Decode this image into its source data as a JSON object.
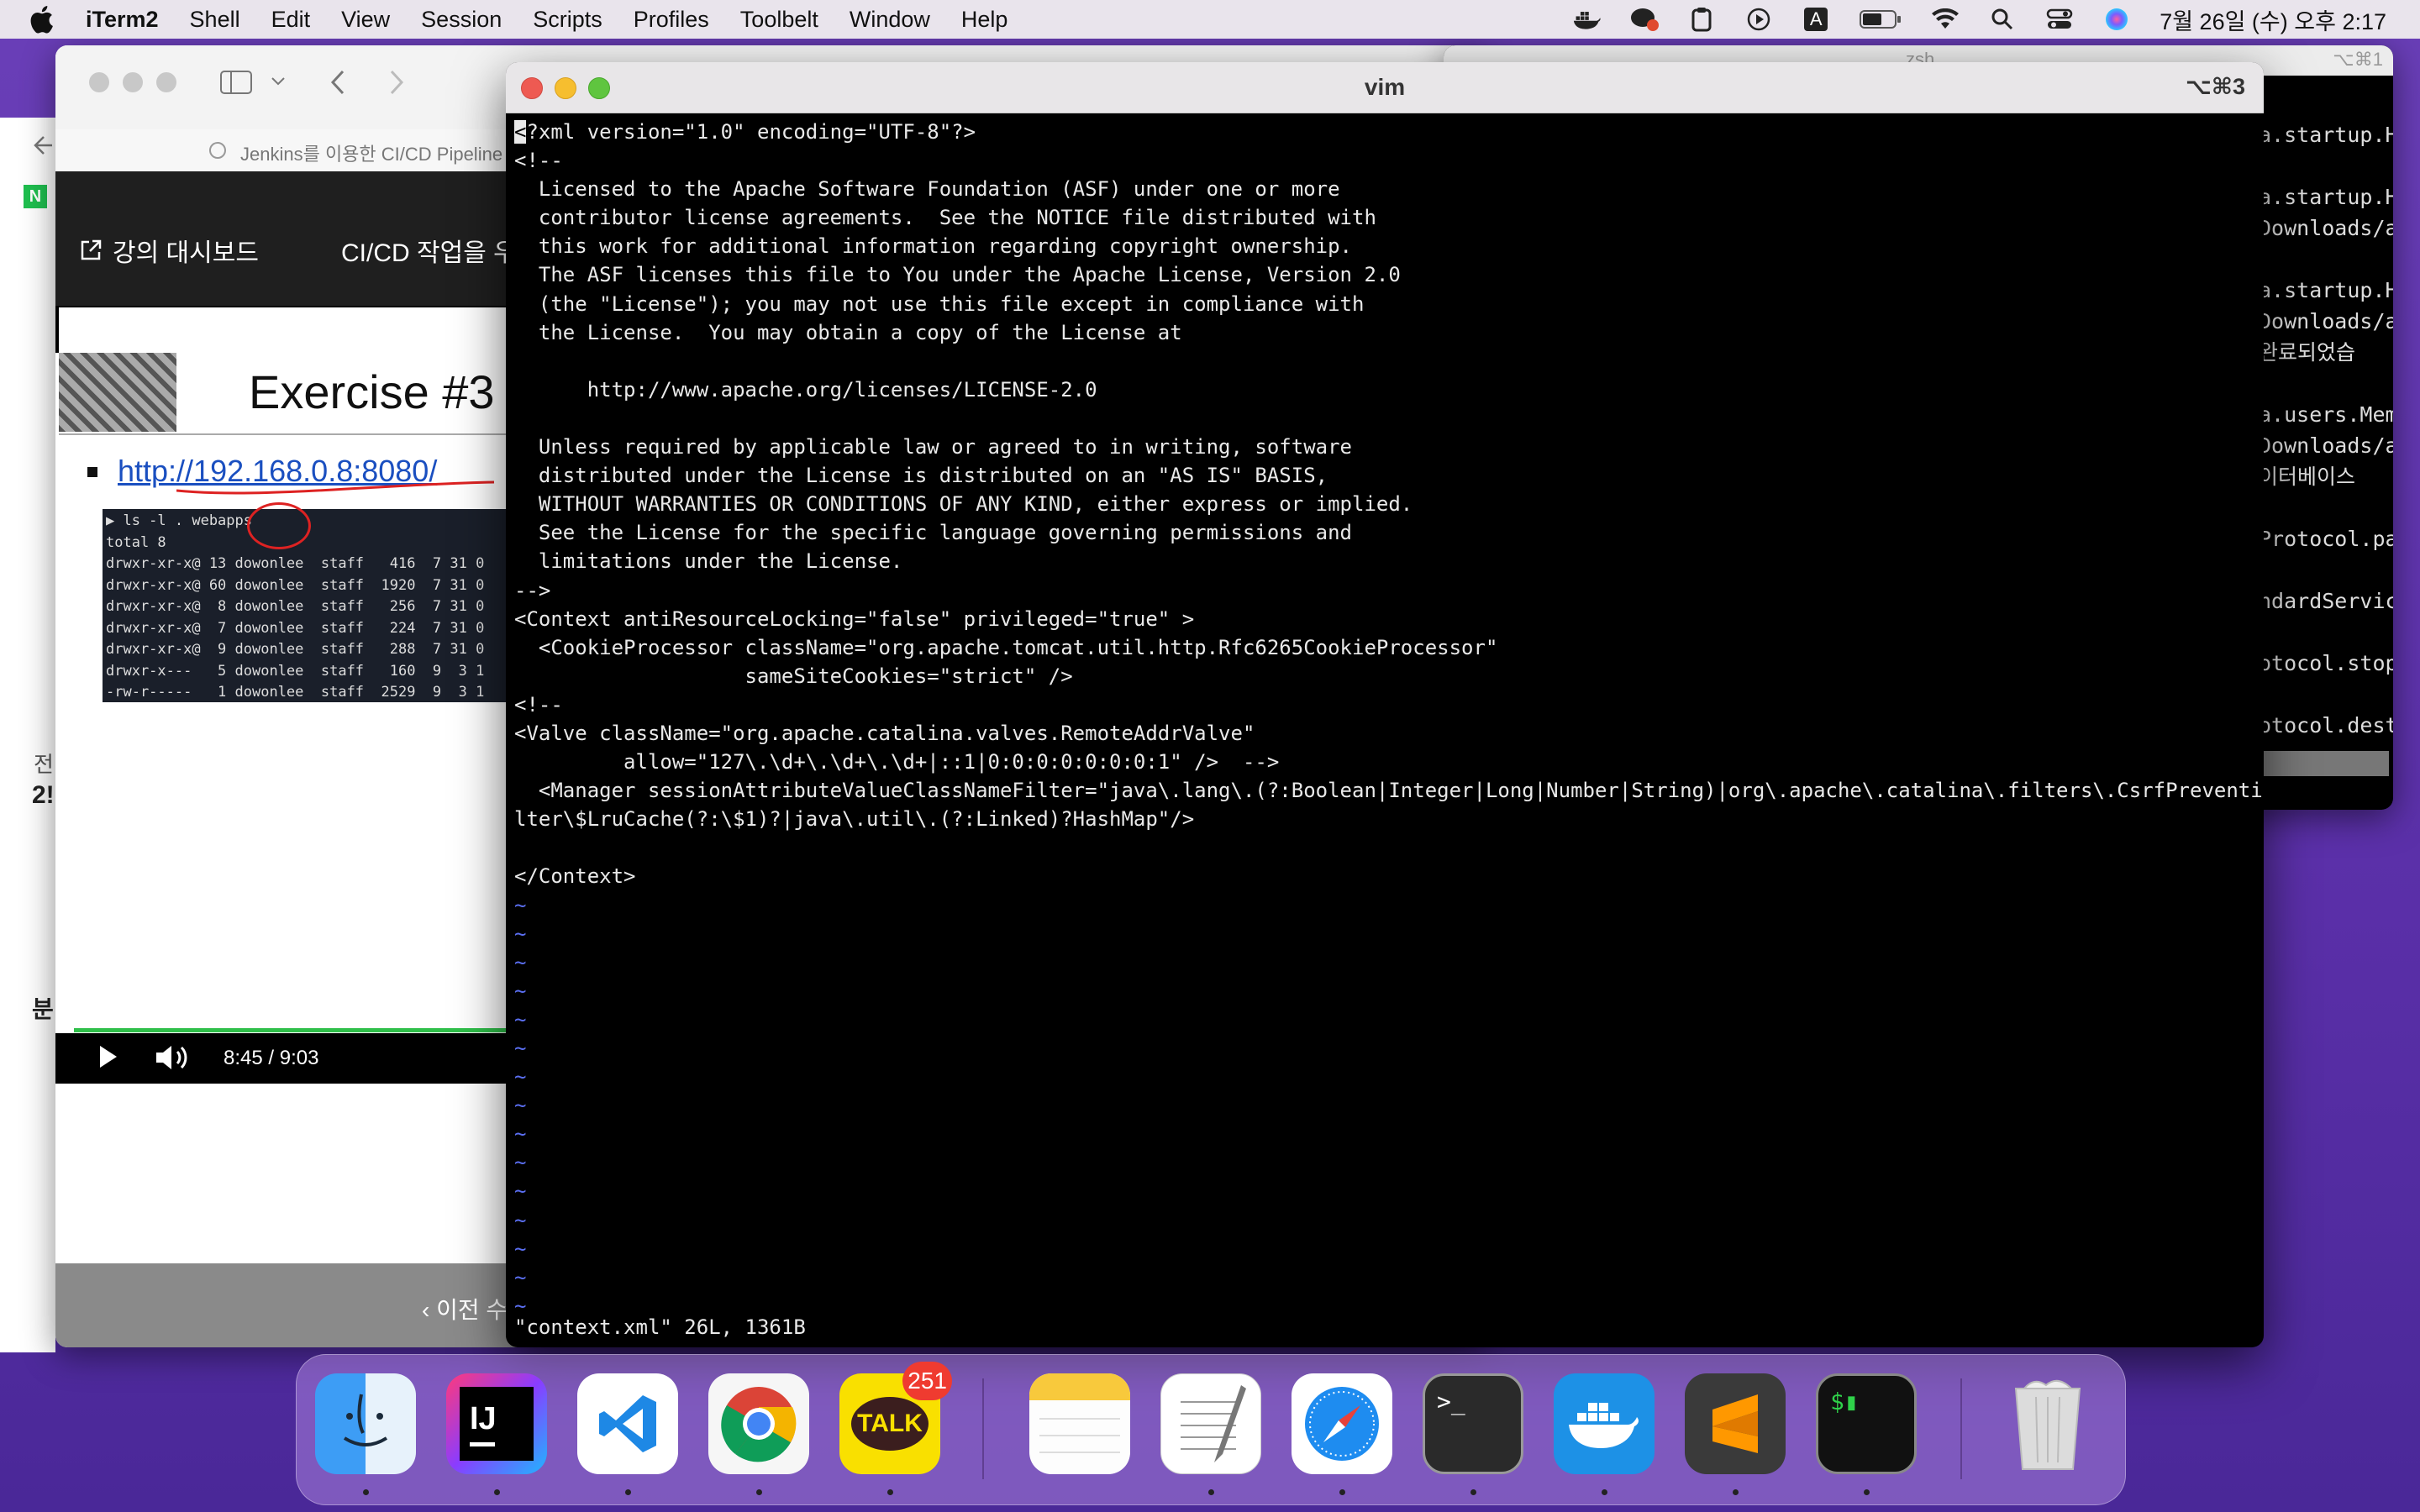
{
  "menubar": {
    "app_name": "iTerm2",
    "items": [
      "Shell",
      "Edit",
      "View",
      "Session",
      "Scripts",
      "Profiles",
      "Toolbelt",
      "Window",
      "Help"
    ],
    "clock": "7월 26일 (수) 오후 2:17",
    "input_source": "A",
    "tray_icons": [
      "docker-icon",
      "kakaotalk-icon",
      "clipboard-icon",
      "play-icon",
      "input-source-icon",
      "battery-icon",
      "wifi-icon",
      "spotlight-search-icon",
      "control-center-icon",
      "siri-icon"
    ]
  },
  "browser": {
    "tab_title": "Jenkins를 이용한 CI/CD Pipeline",
    "dashboard_label": "강의 대시보드",
    "course_title": "CI/CD 작업을 우",
    "slide_title": "Exercise #3",
    "slide_link": "http://192.168.0.8:8080/",
    "terminal_lines": [
      "▶ ls -l . webapps",
      "total 8",
      "drwxr-xr-x@ 13 dowonlee  staff   416  7 31 0",
      "drwxr-xr-x@ 60 dowonlee  staff  1920  7 31 0",
      "drwxr-xr-x@  8 dowonlee  staff   256  7 31 0",
      "drwxr-xr-x@  7 dowonlee  staff   224  7 31 0",
      "drwxr-xr-x@  9 dowonlee  staff   288  7 31 0",
      "drwxr-x---   5 dowonlee  staff   160  9  3 1",
      "-rw-r-----   1 dowonlee  staff  2529  9  3 1"
    ],
    "video_time": "8:45 / 9:03",
    "video_progress": 0.972,
    "prev_label": "이전 수",
    "side_labels": [
      "전",
      "2!",
      "분"
    ]
  },
  "zsh_window": {
    "title": "zsh",
    "shortcut": "⌥⌘1",
    "lines": [
      "a.startup.H",
      "",
      "a.startup.H",
      "Downloads/a",
      "",
      "a.startup.H",
      "Downloads/a",
      "완료되었습",
      "",
      "a.users.Mem",
      "Downloads/a",
      "이터베이스",
      "",
      "Protocol.pa",
      "",
      "ndardServic",
      "",
      "otocol.stop",
      "",
      "otocol.dest"
    ]
  },
  "vim": {
    "title": "vim",
    "shortcut": "⌥⌘3",
    "cursor_char": "<",
    "first_line_rest": "?xml version=\"1.0\" encoding=\"UTF-8\"?>",
    "lines": [
      "<!--",
      "  Licensed to the Apache Software Foundation (ASF) under one or more",
      "  contributor license agreements.  See the NOTICE file distributed with",
      "  this work for additional information regarding copyright ownership.",
      "  The ASF licenses this file to You under the Apache License, Version 2.0",
      "  (the \"License\"); you may not use this file except in compliance with",
      "  the License.  You may obtain a copy of the License at",
      "",
      "      http://www.apache.org/licenses/LICENSE-2.0",
      "",
      "  Unless required by applicable law or agreed to in writing, software",
      "  distributed under the License is distributed on an \"AS IS\" BASIS,",
      "  WITHOUT WARRANTIES OR CONDITIONS OF ANY KIND, either express or implied.",
      "  See the License for the specific language governing permissions and",
      "  limitations under the License.",
      "-->",
      "<Context antiResourceLocking=\"false\" privileged=\"true\" >",
      "  <CookieProcessor className=\"org.apache.tomcat.util.http.Rfc6265CookieProcessor\"",
      "                   sameSiteCookies=\"strict\" />",
      "<!--",
      "<Valve className=\"org.apache.catalina.valves.RemoteAddrValve\"",
      "         allow=\"127\\.\\d+\\.\\d+\\.\\d+|::1|0:0:0:0:0:0:0:1\" />  -->",
      "  <Manager sessionAttributeValueClassNameFilter=\"java\\.lang\\.(?:Boolean|Integer|Long|Number|String)|org\\.apache\\.catalina\\.filters\\.CsrfPreventionFi",
      "lter\\$LruCache(?:\\$1)?|java\\.util\\.(?:Linked)?HashMap\"/>",
      "",
      "</Context>"
    ],
    "tilde": "~",
    "tilde_count": 15,
    "status_line": "\"context.xml\" 26L, 1361B"
  },
  "dock": {
    "apps": [
      "Finder",
      "IntelliJ IDEA",
      "Visual Studio Code",
      "Google Chrome",
      "KakaoTalk",
      "Notes",
      "TextEdit",
      "Safari",
      "Terminal",
      "Docker",
      "Sublime Text",
      "iTerm2",
      "Trash"
    ],
    "kakao_badge": "251",
    "intellij_letters": "IJ",
    "kakao_label": "TALK"
  }
}
